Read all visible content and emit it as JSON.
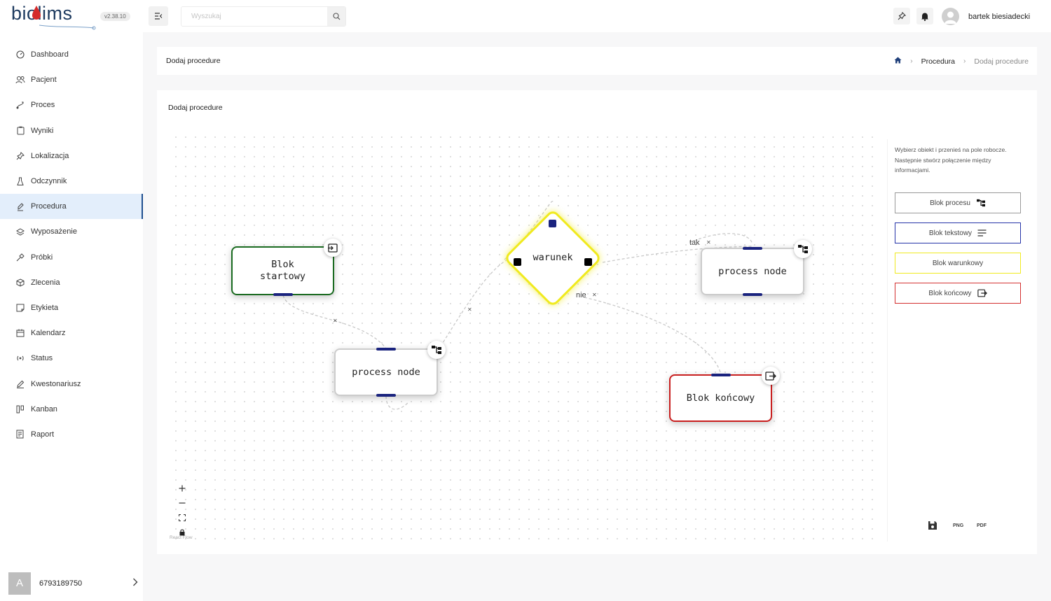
{
  "app": {
    "logo_text": "biolims",
    "version": "v2.38.10"
  },
  "sidebar": {
    "items": [
      {
        "label": "Dashboard",
        "icon": "dashboard-icon"
      },
      {
        "label": "Pacjent",
        "icon": "users-icon"
      },
      {
        "label": "Proces",
        "icon": "route-icon"
      },
      {
        "label": "Wyniki",
        "icon": "clipboard-icon"
      },
      {
        "label": "Lokalizacja",
        "icon": "pin-icon"
      },
      {
        "label": "Odczynnik",
        "icon": "flask-icon"
      },
      {
        "label": "Procedura",
        "icon": "note-icon",
        "active": true
      },
      {
        "label": "Wyposażenie",
        "icon": "layers-icon"
      },
      {
        "label": "Próbki",
        "icon": "pipette-icon"
      },
      {
        "label": "Zlecenia",
        "icon": "package-icon"
      },
      {
        "label": "Etykieta",
        "icon": "sticky-note-icon"
      },
      {
        "label": "Kalendarz",
        "icon": "calendar-icon"
      },
      {
        "label": "Status",
        "icon": "broadcast-icon"
      },
      {
        "label": "Kwestonariusz",
        "icon": "pencil-icon"
      },
      {
        "label": "Kanban",
        "icon": "kanban-icon"
      },
      {
        "label": "Raport",
        "icon": "report-icon"
      }
    ],
    "user": {
      "initial": "A",
      "id": "6793189750"
    }
  },
  "topbar": {
    "search_placeholder": "Wyszukaj",
    "user_name": "bartek biesiadecki"
  },
  "header": {
    "title": "Dodaj procedure",
    "breadcrumb": [
      "Procedura",
      "Dodaj procedure"
    ]
  },
  "main": {
    "title": "Dodaj procedure",
    "nodes": {
      "start": "Blok\nstartowy",
      "process1": "process node",
      "condition": "warunek",
      "process2": "process node",
      "end": "Blok końcowy"
    },
    "edge_labels": {
      "yes": "tak",
      "no": "nie"
    },
    "attribution": "React Flow"
  },
  "palette": {
    "info": "Wybierz obiekt i przenieś na pole robocze. Następnie stwórz połączenie między informacjami.",
    "buttons": {
      "process": "Blok procesu",
      "text": "Blok tekstowy",
      "condition": "Blok warunkowy",
      "end": "Blok końcowy"
    },
    "export": {
      "png": "PNG",
      "pdf": "PDF"
    }
  },
  "colors": {
    "start_border": "#1a6b20",
    "condition_border": "#f0ea1f",
    "end_border": "#c91f1f",
    "text_block_border": "#2634a8",
    "handle": "#1a237e",
    "active_nav_bg": "#e3eefb"
  }
}
